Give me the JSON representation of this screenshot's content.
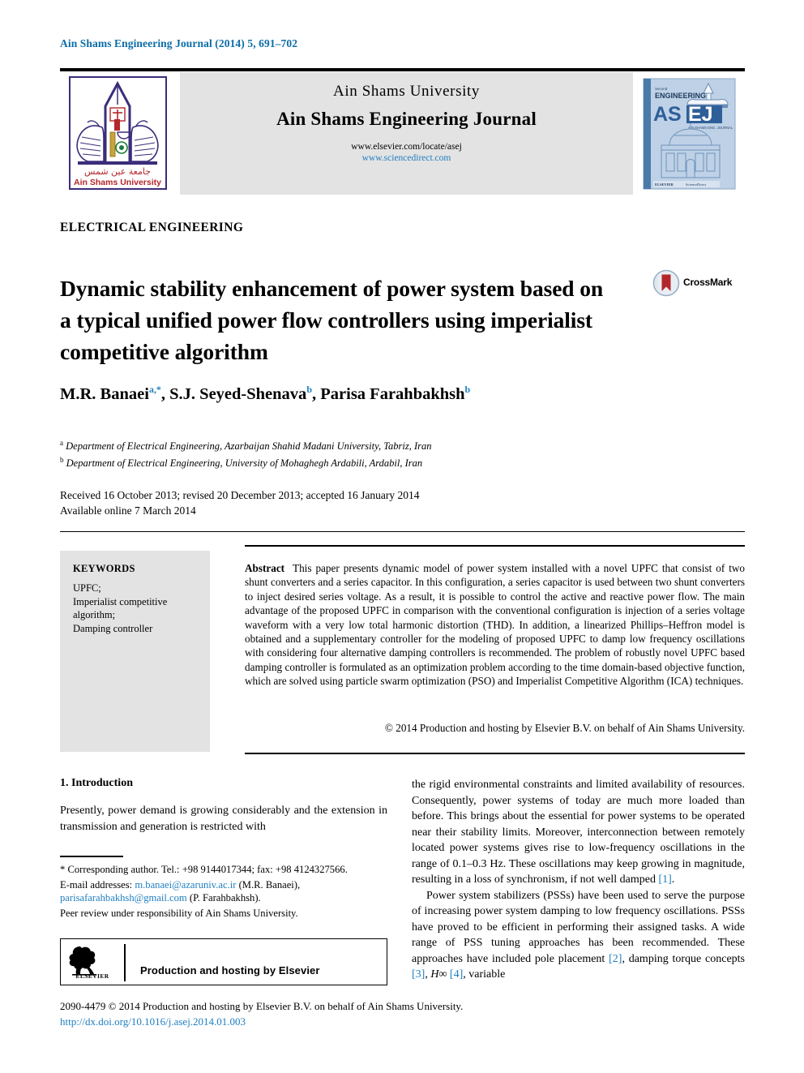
{
  "running_head": "Ain Shams Engineering Journal (2014) 5, 691–702",
  "masthead": {
    "university": "Ain Shams University",
    "journal": "Ain Shams Engineering Journal",
    "url_elsevier": "www.elsevier.com/locate/asej",
    "url_sciencedirect": "www.sciencedirect.com",
    "logo_caption_ar": "جامعة عين شمس",
    "logo_caption_en": "Ain Shams University",
    "cover": {
      "line_small": "Second",
      "line_engineering": "ENGINEERING",
      "acronym_as": "AS",
      "acronym_ej": "EJ",
      "subtitle": "AIN SHAMS ENGINEERING JOURNAL",
      "footer_left": "ELSEVIER",
      "footer_right": "ScienceDirect"
    }
  },
  "section_field": "ELECTRICAL ENGINEERING",
  "title": "Dynamic stability enhancement of power system based on a typical unified power flow controllers using imperialist competitive algorithm",
  "crossmark": {
    "label": "CrossMark",
    "icon": "crossmark-icon"
  },
  "authors": [
    {
      "name": "M.R. Banaei",
      "sup": "a,*"
    },
    {
      "name": "S.J. Seyed-Shenava",
      "sup": "b"
    },
    {
      "name": "Parisa Farahbakhsh",
      "sup": "b"
    }
  ],
  "affiliations": [
    {
      "marker": "a",
      "text": "Department of Electrical Engineering, Azarbaijan Shahid Madani University, Tabriz, Iran"
    },
    {
      "marker": "b",
      "text": "Department of Electrical Engineering, University of Mohaghegh Ardabili, Ardabil, Iran"
    }
  ],
  "history": {
    "line1": "Received 16 October 2013; revised 20 December 2013; accepted 16 January 2014",
    "line2": "Available online 7 March 2014"
  },
  "keywords": {
    "heading": "KEYWORDS",
    "items": "UPFC;\nImperialist competitive algorithm;\nDamping controller"
  },
  "abstract": {
    "label": "Abstract",
    "text": "This paper presents dynamic model of power system installed with a novel UPFC that consist of two shunt converters and a series capacitor. In this configuration, a series capacitor is used between two shunt converters to inject desired series voltage. As a result, it is possible to control the active and reactive power flow. The main advantage of the proposed UPFC in comparison with the conventional configuration is injection of a series voltage waveform with a very low total harmonic distortion (THD). In addition, a linearized Phillips–Heffron model is obtained and a supplementary controller for the modeling of proposed UPFC to damp low frequency oscillations with considering four alternative damping controllers is recommended. The problem of robustly novel UPFC based damping controller is formulated as an optimization problem according to the time domain-based objective function, which are solved using particle swarm optimization (PSO) and Imperialist Competitive Algorithm (ICA) techniques.",
    "copyright": "© 2014 Production and hosting by Elsevier B.V. on behalf of Ain Shams University."
  },
  "body": {
    "intro_heading": "1. Introduction",
    "left_para1": "Presently, power demand is growing considerably and the extension in transmission and generation is restricted with",
    "right_para1": "the rigid environmental constraints and limited availability of resources. Consequently, power systems of today are much more loaded than before. This brings about the essential for power systems to be operated near their stability limits. Moreover, interconnection between remotely located power systems gives rise to low-frequency oscillations in the range of 0.1–0.3 Hz. These oscillations may keep growing in magnitude, resulting in a loss of synchronism, if not well damped ",
    "right_para1_ref": "[1]",
    "right_para1_tail": ".",
    "right_para2_a": "Power system stabilizers (PSSs) have been used to serve the purpose of increasing power system damping to low frequency oscillations. PSSs have proved to be efficient in performing their assigned tasks. A wide range of PSS tuning approaches has been recommended. These approaches have included pole placement ",
    "right_para2_ref1": "[2]",
    "right_para2_b": ", damping torque concepts ",
    "right_para2_ref2": "[3]",
    "right_para2_c": ", ",
    "right_para2_hinf": "H∞",
    "right_para2_d": " ",
    "right_para2_ref3": "[4]",
    "right_para2_e": ", variable"
  },
  "footnotes": {
    "corresponding": "* Corresponding author. Tel.: +98 9144017344; fax: +98 4124327566.",
    "email_label": "E-mail addresses:",
    "email1": "m.banaei@azaruniv.ac.ir",
    "email1_owner": " (M.R. Banaei), ",
    "email2": "parisafarahbakhsh@gmail.com",
    "email2_owner": " (P. Farahbakhsh).",
    "peer_review": "Peer review under responsibility of Ain Shams University."
  },
  "production_box": {
    "text": "Production and hosting by Elsevier",
    "logo_word": "ELSEVIER"
  },
  "footer": {
    "issn_line": "2090-4479 © 2014 Production and hosting by Elsevier B.V. on behalf of Ain Shams University.",
    "doi": "http://dx.doi.org/10.1016/j.asej.2014.01.003"
  },
  "colors": {
    "link_blue": "#1f7fc0",
    "running_head_blue": "#0b6ca8",
    "band_grey": "#e3e3e3",
    "logo_purple": "#3b2d7a",
    "logo_red": "#b3262a",
    "cover_blue": "#6b93c4"
  }
}
